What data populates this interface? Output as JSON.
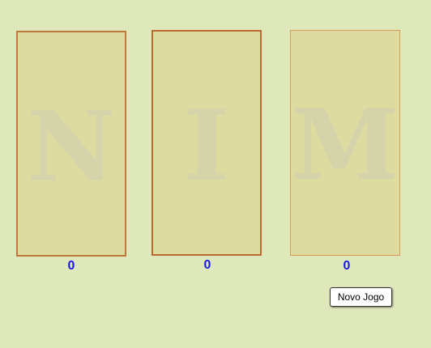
{
  "piles": [
    {
      "letter": "N",
      "count": "0"
    },
    {
      "letter": "I",
      "count": "0"
    },
    {
      "letter": "M",
      "count": "0"
    }
  ],
  "new_game_label": "Novo Jogo",
  "colors": {
    "background": "#dfe8bb",
    "pile_fill": "#dedba1",
    "pile_border": "#c0773a",
    "count_text": "#1a1ae6"
  }
}
